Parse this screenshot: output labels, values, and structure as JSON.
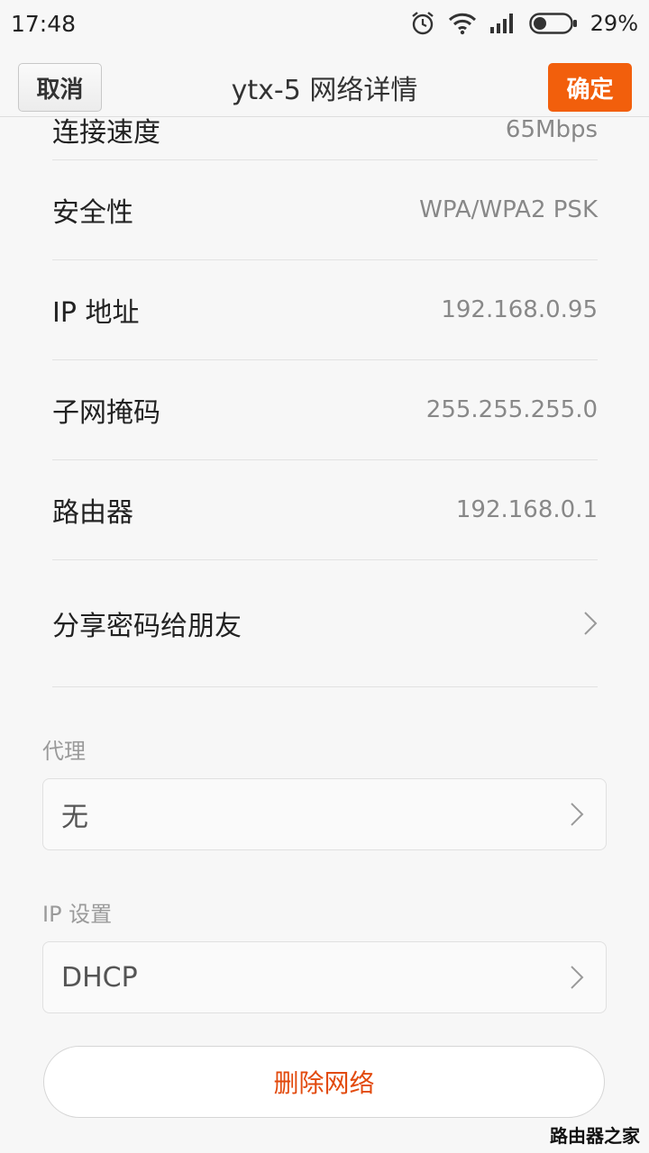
{
  "status_bar": {
    "time": "17:48",
    "battery": "29%",
    "icons": [
      "alarm-icon",
      "wifi-icon",
      "signal-icon",
      "battery-icon"
    ]
  },
  "action_bar": {
    "cancel_label": "取消",
    "title": "ytx-5 网络详情",
    "ok_label": "确定",
    "accent": "#f25f0c"
  },
  "details": {
    "partial_row": {
      "label": "连接速度",
      "value": "65Mbps"
    },
    "security": {
      "label": "安全性",
      "value": "WPA/WPA2 PSK"
    },
    "ip": {
      "label": "IP 地址",
      "value": "192.168.0.95"
    },
    "subnet": {
      "label": "子网掩码",
      "value": "255.255.255.0"
    },
    "router": {
      "label": "路由器",
      "value": "192.168.0.1"
    },
    "share": {
      "label": "分享密码给朋友"
    }
  },
  "proxy": {
    "section_label": "代理",
    "value": "无"
  },
  "ip_settings": {
    "section_label": "IP 设置",
    "value": "DHCP"
  },
  "delete_label": "删除网络",
  "delete_color": "#e24a0d",
  "watermark": "路由器之家"
}
